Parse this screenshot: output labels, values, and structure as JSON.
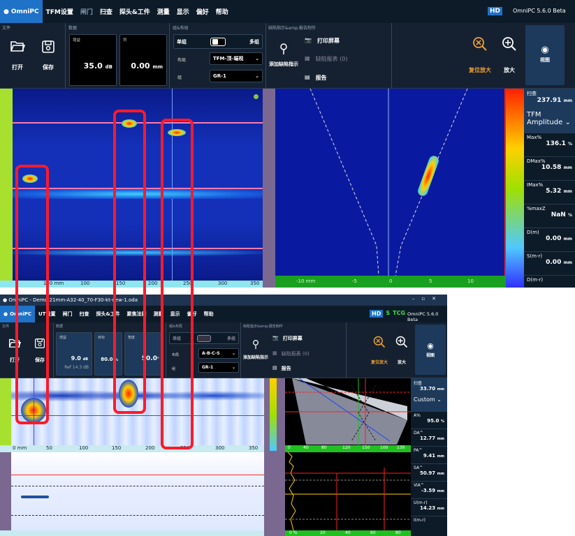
{
  "top": {
    "logo": "OmniPC",
    "menu": [
      "TFM设置",
      "闸门",
      "扫查",
      "探头&工件",
      "测量",
      "显示",
      "偏好",
      "帮助"
    ],
    "hd": "HD",
    "version": "OmniPC 5.6.0 Beta",
    "sections": {
      "file": "文件",
      "data": "数据",
      "group": "组&布局",
      "defect": "缺陷指示&amp;报告制作"
    },
    "open": "打开",
    "save": "保存",
    "gain_label": "增益",
    "gain_value": "35.0",
    "gain_unit": "dB",
    "col_label": "列",
    "col_value": "0.00",
    "col_unit": "mm",
    "single": "单组",
    "multi": "多组",
    "layout_label": "布局",
    "layout_value": "TFM-顶-端视",
    "group_label": "组",
    "group_value": "GR-1",
    "add_defect": "添加缺陷指示",
    "print_screen": "打印屏幕",
    "defect_table": "缺陷报表 (0)",
    "report": "报告",
    "reset_zoom": "复位放大",
    "zoom": "放大",
    "view": "视图",
    "axis": [
      "150 mm",
      "100",
      "150",
      "200",
      "250",
      "300",
      "350"
    ],
    "b_axis": [
      "-10 mm",
      "-5",
      "0",
      "5",
      "10"
    ],
    "readouts": [
      {
        "label": "扫查",
        "value": "237.91",
        "unit": "mm"
      },
      {
        "label": "TFM Amplitude",
        "value": "",
        "unit": ""
      },
      {
        "label": "Max%",
        "value": "136.1",
        "unit": "%"
      },
      {
        "label": "DMax%",
        "value": "10.58",
        "unit": "mm"
      },
      {
        "label": "IMax%",
        "value": "5.32",
        "unit": "mm"
      },
      {
        "label": "%maxZ",
        "value": "NaN",
        "unit": "%"
      },
      {
        "label": "D(m)",
        "value": "0.00",
        "unit": "mm"
      },
      {
        "label": "S(m-r)",
        "value": "0.00",
        "unit": "mm"
      },
      {
        "label": "D(m-r)",
        "value": "",
        "unit": ""
      }
    ]
  },
  "bottom": {
    "title": "OmniPC - Demo-21mm-A32-40_70-F30-kt-new-1.oda",
    "logo": "OmniPC",
    "menu": [
      "UT设置",
      "闸门",
      "扫查",
      "探头&工件",
      "聚焦法则",
      "测量",
      "显示",
      "偏好",
      "帮助"
    ],
    "hd": "HD",
    "s": "S",
    "tcg": "TCG",
    "version": "OmniPC 5.6.0 Beta",
    "sections": {
      "file": "文件",
      "data": "数据",
      "group": "组&布局",
      "defect": "缺陷指示&amp;报告制作"
    },
    "open": "打开",
    "save": "保存",
    "gain_label": "增益",
    "gain_value": "9.0",
    "gain_unit": "dB",
    "ref": "Ref 14.3 dB",
    "angle_lbl": "目标",
    "angle_value": "80.0",
    "angle_unit": "%",
    "deg_label": "角度",
    "deg_value": "50.0",
    "deg_unit": "°",
    "single": "单组",
    "multi": "多组",
    "layout_label": "布局",
    "layout_value": "A-B-C-S",
    "group_label": "组",
    "group_value": "GR-1",
    "add_defect": "添加缺陷指示",
    "print_screen": "打印屏幕",
    "defect_table": "缺陷报表 (0)",
    "report": "报告",
    "reset_zoom": "复位放大",
    "zoom": "放大",
    "view": "视图",
    "axis": [
      "0 mm",
      "50",
      "100",
      "150",
      "200",
      "250",
      "300",
      "350"
    ],
    "s_axis": [
      "0",
      "40",
      "80",
      "120",
      "150",
      "100",
      "130"
    ],
    "a_axis": [
      "0 %",
      "20",
      "40",
      "60",
      "80"
    ],
    "readouts": [
      {
        "label": "扫查",
        "value": "33.70",
        "unit": "mm"
      },
      {
        "label": "Custom",
        "value": "",
        "unit": ""
      },
      {
        "label": "A%",
        "value": "95.0",
        "unit": "%"
      },
      {
        "label": "DA^",
        "value": "12.77",
        "unit": "mm"
      },
      {
        "label": "PA^",
        "value": "9.41",
        "unit": "mm"
      },
      {
        "label": "SA^",
        "value": "50.97",
        "unit": "mm"
      },
      {
        "label": "ViA^",
        "value": "-3.59",
        "unit": "mm"
      },
      {
        "label": "U(m-r)",
        "value": "14.23",
        "unit": "mm"
      },
      {
        "label": "I(m-r)",
        "value": "",
        "unit": ""
      }
    ]
  },
  "colors": {
    "accent": "#1e72c8",
    "orange": "#f0a030",
    "highlight": "#ff1a2a"
  }
}
